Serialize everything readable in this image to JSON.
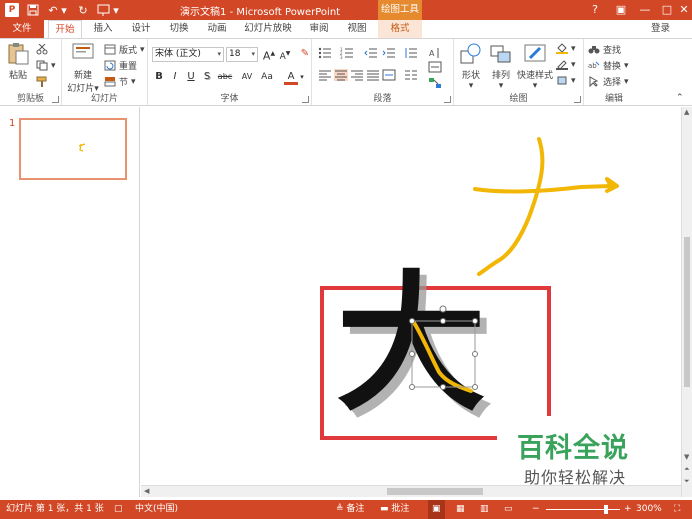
{
  "titlebar": {
    "title": "演示文稿1 - Microsoft PowerPoint",
    "context_tab_group": "绘图工具",
    "logo_letter": "P",
    "help": "?"
  },
  "tabs": {
    "file": "文件",
    "items": [
      "开始",
      "插入",
      "设计",
      "切换",
      "动画",
      "幻灯片放映",
      "审阅",
      "视图",
      "格式"
    ],
    "login": "登录"
  },
  "ribbon": {
    "clipboard": {
      "label": "剪贴板",
      "paste": "粘贴"
    },
    "slides": {
      "label": "幻灯片",
      "new_slide_1": "新建",
      "new_slide_2": "幻灯片",
      "layout": "版式",
      "reset": "重置",
      "section": "节"
    },
    "font": {
      "label": "字体",
      "font_name": "宋体 (正文)",
      "font_size": "18",
      "bold": "B",
      "italic": "I",
      "underline": "U",
      "shadow": "S",
      "strike": "abc",
      "spacing": "AV",
      "case": "Aa",
      "color_letter": "A"
    },
    "paragraph": {
      "label": "段落"
    },
    "drawing": {
      "label": "绘图",
      "shapes": "形状",
      "arrange": "排列",
      "quick_styles": "快速样式"
    },
    "editing": {
      "label": "编辑",
      "find": "查找",
      "replace": "替换",
      "select": "选择"
    }
  },
  "thumbnails": {
    "slide_number": "1"
  },
  "slide": {
    "character": "大",
    "colors": {
      "stroke": "#f2b705",
      "frame": "#e0393b",
      "glyph": "#111111"
    }
  },
  "watermark": {
    "title": "百科全说",
    "subtitle": "助你轻松解决"
  },
  "statusbar": {
    "slide_info": "幻灯片 第 1 张，共 1 张",
    "language": "中文(中国)",
    "notes": "备注",
    "comments": "批注",
    "zoom": "300%"
  },
  "colors": {
    "accent": "#d24726",
    "context": "#e58a2f"
  }
}
